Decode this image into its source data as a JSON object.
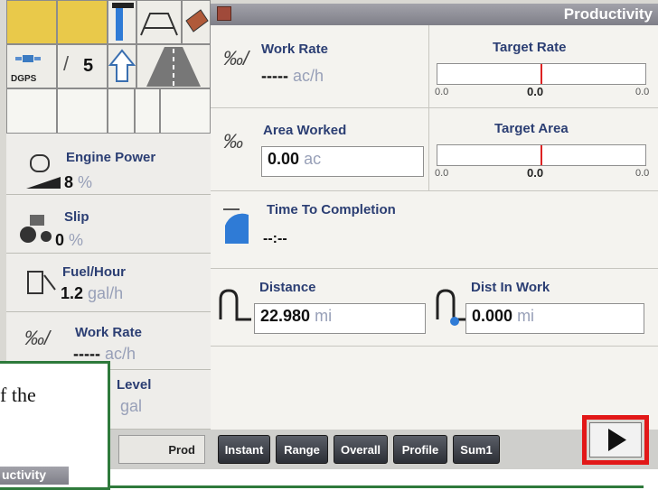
{
  "status_icons": {
    "gps_label": "DGPS",
    "signal_count": "5"
  },
  "left_widgets": [
    {
      "name": "engine-power",
      "label": "Engine Power",
      "value": "8",
      "unit": "%"
    },
    {
      "name": "slip",
      "label": "Slip",
      "value": "0",
      "unit": "%"
    },
    {
      "name": "fuel-hour",
      "label": "Fuel/Hour",
      "value": "1.2",
      "unit": "gal/h"
    },
    {
      "name": "work-rate",
      "label": "Work Rate",
      "value": "-----",
      "unit": "ac/h"
    },
    {
      "name": "level",
      "label": "Level",
      "value": "",
      "unit": "gal"
    }
  ],
  "page_tab": "Prod",
  "title": "Productivity",
  "work_rate": {
    "label": "Work Rate",
    "value": "-----",
    "unit": "ac/h"
  },
  "target_rate": {
    "label": "Target Rate",
    "min": "0.0",
    "center": "0.0",
    "max": "0.0",
    "marker_fraction": 0.5
  },
  "area_worked": {
    "label": "Area Worked",
    "value": "0.00",
    "unit": "ac"
  },
  "target_area": {
    "label": "Target Area",
    "min": "0.0",
    "center": "0.0",
    "max": "0.0",
    "marker_fraction": 0.5
  },
  "time_to_completion": {
    "label": "Time To Completion",
    "value": "--:--"
  },
  "distance": {
    "label": "Distance",
    "value": "22.980",
    "unit": "mi"
  },
  "dist_in_work": {
    "label": "Dist In Work",
    "value": "0.000",
    "unit": "mi"
  },
  "bottom_buttons": [
    "Instant",
    "Range",
    "Overall",
    "Profile",
    "Sum1"
  ],
  "callout": {
    "text": "f the",
    "mini_title": "uctivity"
  }
}
